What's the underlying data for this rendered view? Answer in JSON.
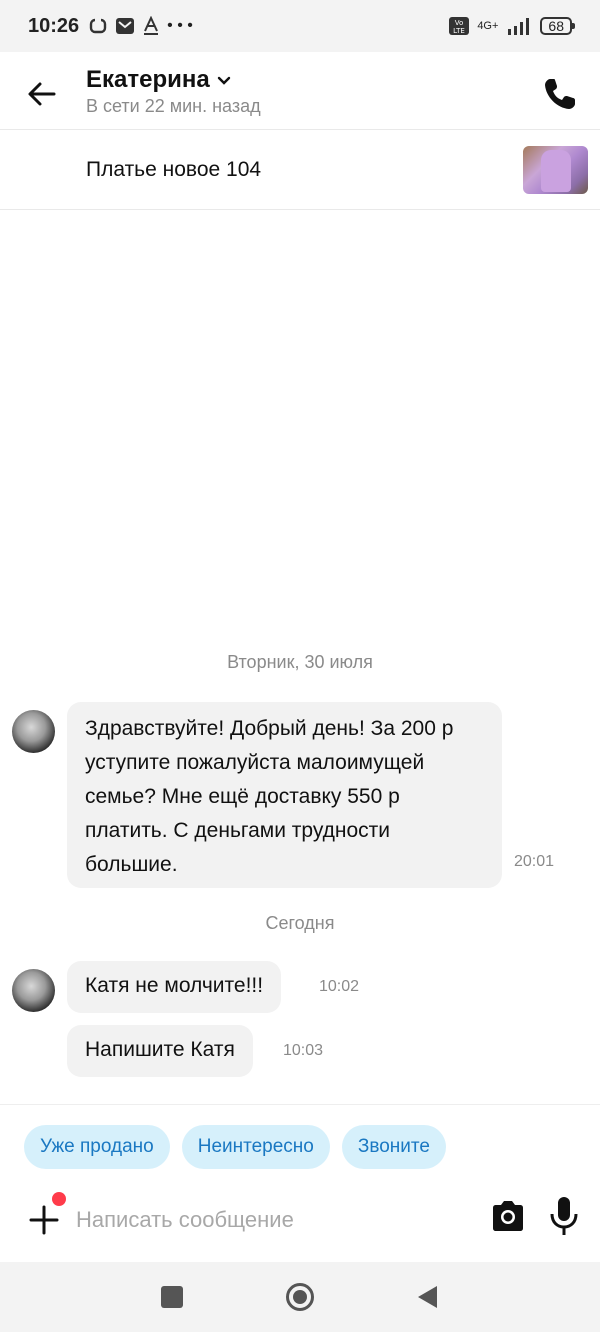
{
  "status_bar": {
    "time": "10:26",
    "network": "4G+",
    "battery": "68"
  },
  "header": {
    "contact_name": "Екатерина",
    "contact_status": "В сети 22 мин. назад"
  },
  "ad": {
    "title": "Платье новое 104"
  },
  "chat": {
    "date_1": "Вторник, 30 июля",
    "message_1": {
      "text": "Здравствуйте! Добрый день! За 200 р уступите пожалуйста малоимущей семье? Мне ещё доставку 550 р платить. С деньгами трудности большие.",
      "time": "20:01"
    },
    "date_2": "Сегодня",
    "message_2": {
      "text": "Катя не молчите!!!",
      "time": "10:02"
    },
    "message_3": {
      "text": "Напишите Катя",
      "time": "10:03"
    }
  },
  "quick_replies": [
    "Уже продано",
    "Неинтересно",
    "Звоните"
  ],
  "composer": {
    "placeholder": "Написать сообщение"
  },
  "colors": {
    "chip_bg": "#d6f0fb",
    "chip_text": "#1a78c2",
    "bubble_bg": "#f2f2f2",
    "notification_dot": "#ff3b4a"
  }
}
